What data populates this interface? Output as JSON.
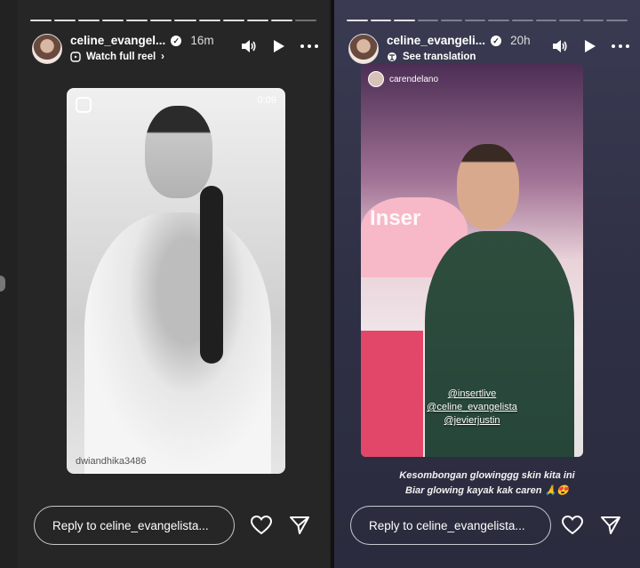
{
  "left_story": {
    "username": "celine_evangel...",
    "time": "16m",
    "subline": "Watch full reel",
    "duration": "0:09",
    "credit": "dwiandhika3486",
    "reply_placeholder": "Reply to celine_evangelista..."
  },
  "right_story": {
    "username": "celine_evangeli...",
    "time": "20h",
    "subline": "See translation",
    "reposted_from": "carendelano",
    "studio_text": "Inser",
    "mentions": [
      "@insertlive",
      "@celine_evangelista",
      "@jevierjustin"
    ],
    "caption_line1": "Kesombongan glowinggg skin kita ini",
    "caption_line2": "Biar glowing kayak kak caren 🙏😍",
    "reply_placeholder": "Reply to celine_evangelista..."
  },
  "icons": {
    "verified": "verified-badge-icon",
    "sound": "speaker-icon",
    "play": "play-icon",
    "more": "more-horizontal-icon",
    "heart": "heart-icon",
    "share": "send-icon",
    "reel": "reel-icon"
  },
  "colors": {
    "left_bg": "#262626",
    "right_bg": "#2f3046",
    "couch": "#e24769",
    "dress": "#2f4d3d"
  }
}
